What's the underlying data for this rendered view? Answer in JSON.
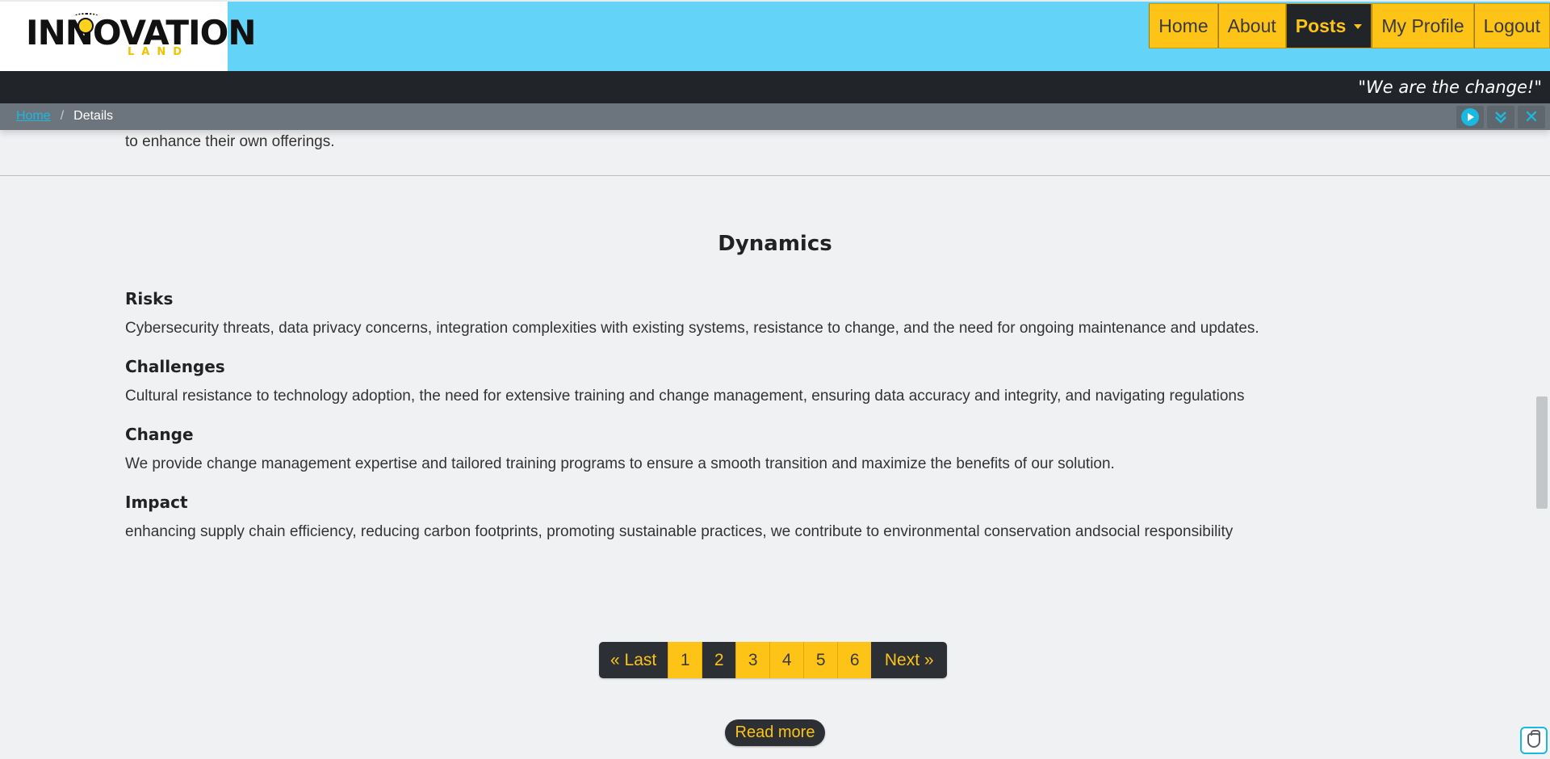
{
  "brand": {
    "logo_main": "INNOVATION",
    "logo_sub": "LAND",
    "slogan": "\"We are the change!\""
  },
  "nav": {
    "home": "Home",
    "about": "About",
    "posts": "Posts",
    "profile": "My Profile",
    "logout": "Logout"
  },
  "breadcrumb": {
    "home": "Home",
    "separator": "/",
    "current": "Details"
  },
  "toolbar": {
    "play_icon": "play-circle-icon",
    "expand_icon": "double-chevron-down-icon",
    "close_icon": "close-icon",
    "close_glyph": "✕",
    "expand_glyph": "⌄"
  },
  "content": {
    "top_text": "to enhance their own offerings.",
    "section_title": "Dynamics",
    "items": [
      {
        "heading": "Risks",
        "text": "Cybersecurity threats, data privacy concerns, integration complexities with existing systems, resistance to change, and the need for ongoing maintenance and updates."
      },
      {
        "heading": "Challenges",
        "text": "Cultural resistance to technology adoption, the need for extensive training and change management, ensuring data accuracy and integrity, and navigating regulations"
      },
      {
        "heading": "Change",
        "text": "We provide change management expertise and tailored training programs to ensure a smooth transition and maximize the benefits of our solution."
      },
      {
        "heading": "Impact",
        "text": "enhancing supply chain efficiency, reducing carbon footprints, promoting sustainable practices, we contribute to environmental conservation andsocial responsibility"
      }
    ]
  },
  "pagination": {
    "prev_label": "«  Last",
    "pages": [
      "1",
      "2",
      "3",
      "4",
      "5",
      "6"
    ],
    "current_page": "2",
    "next_label": "Next  »"
  },
  "read_more_label": "Read more",
  "colors": {
    "header_bg": "#63d3f8",
    "accent": "#fdc317",
    "dark": "#212529",
    "link": "#1ab9e0"
  }
}
